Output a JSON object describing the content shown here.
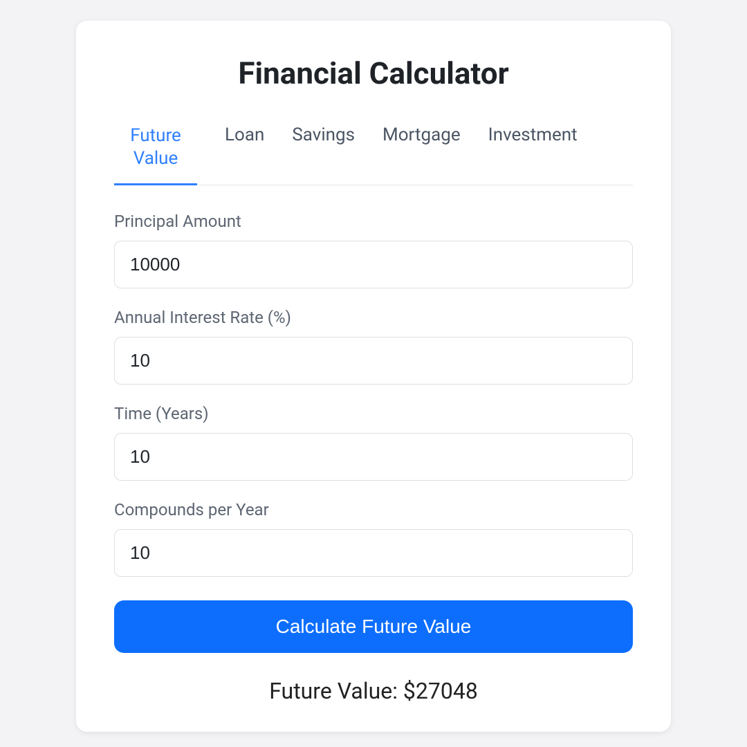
{
  "title": "Financial Calculator",
  "tabs": {
    "futureValue": "Future Value",
    "loan": "Loan",
    "savings": "Savings",
    "mortgage": "Mortgage",
    "investment": "Investment"
  },
  "fields": {
    "principal": {
      "label": "Principal Amount",
      "value": "10000"
    },
    "rate": {
      "label": "Annual Interest Rate (%)",
      "value": "10"
    },
    "time": {
      "label": "Time (Years)",
      "value": "10"
    },
    "compounds": {
      "label": "Compounds per Year",
      "value": "10"
    }
  },
  "button": "Calculate Future Value",
  "result": "Future Value: $27048"
}
